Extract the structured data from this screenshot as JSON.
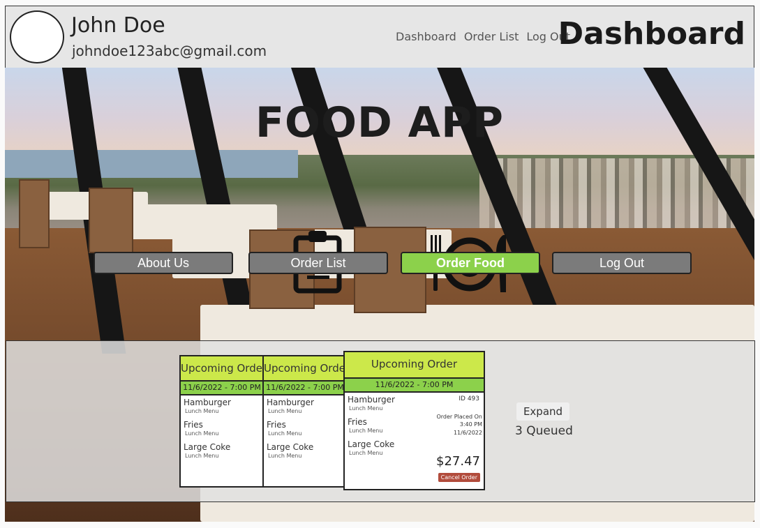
{
  "header": {
    "user_name": "John Doe",
    "user_email": "johndoe123abc@gmail.com",
    "nav": [
      "Dashboard",
      "Order List",
      "Log Out"
    ],
    "page_title": "Dashboard"
  },
  "hero": {
    "app_title": "FOOD APP",
    "buttons": {
      "about": "About Us",
      "orders": "Order List",
      "food": "Order Food",
      "logout": "Log Out"
    }
  },
  "orders": {
    "cards": [
      {
        "title": "Upcoming Order",
        "date": "11/6/2022 - 7:00 PM",
        "items": [
          {
            "name": "Hamburger",
            "menu": "Lunch Menu"
          },
          {
            "name": "Fries",
            "menu": "Lunch Menu"
          },
          {
            "name": "Large Coke",
            "menu": "Lunch Menu"
          }
        ]
      },
      {
        "title": "Upcoming Order",
        "date": "11/6/2022 - 7:00 PM",
        "items": [
          {
            "name": "Hamburger",
            "menu": "Lunch Menu"
          },
          {
            "name": "Fries",
            "menu": "Lunch Menu"
          },
          {
            "name": "Large Coke",
            "menu": "Lunch Menu"
          }
        ]
      },
      {
        "title": "Upcoming Order",
        "date": "11/6/2022 - 7:00 PM",
        "items": [
          {
            "name": "Hamburger",
            "menu": "Lunch Menu"
          },
          {
            "name": "Fries",
            "menu": "Lunch Menu"
          },
          {
            "name": "Large Coke",
            "menu": "Lunch Menu"
          }
        ],
        "id": "ID 493",
        "placed_label": "Order Placed On",
        "placed_time": "3:40 PM",
        "placed_date": "11/6/2022",
        "total": "$27.47",
        "cancel": "Cancel Order"
      }
    ],
    "expand": "Expand",
    "queued": "3 Queued"
  },
  "colors": {
    "accent_green": "#8cd14b",
    "header_yellow_green": "#cce84a",
    "cancel_red": "#b24c3c"
  }
}
